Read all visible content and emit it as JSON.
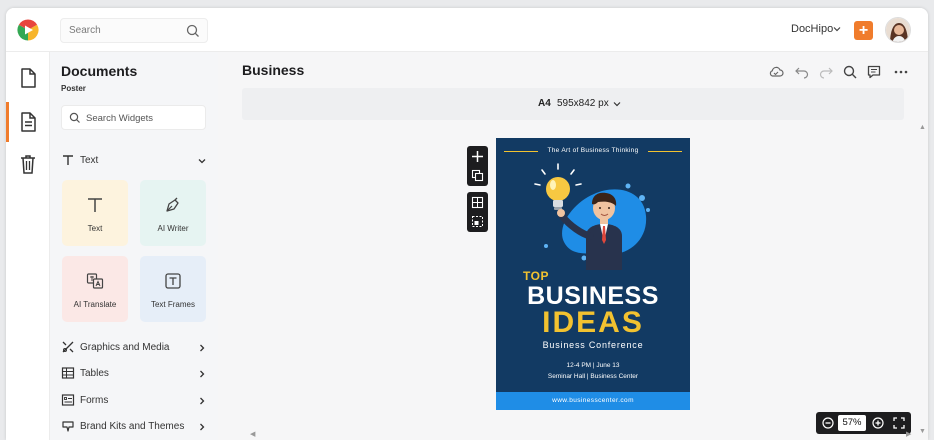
{
  "header": {
    "search_placeholder": "Search",
    "brand_menu": "DocHipo",
    "add_label": "+"
  },
  "panel": {
    "title": "Documents",
    "subtitle": "Poster",
    "search_placeholder": "Search Widgets",
    "text_section": "Text",
    "cards": [
      {
        "label": "Text",
        "bg": "#fdf3de"
      },
      {
        "label": "AI Writer",
        "bg": "#e6f4f2"
      },
      {
        "label": "AI Translate",
        "bg": "#fbe8e6"
      },
      {
        "label": "Text Frames",
        "bg": "#e6eef8"
      }
    ],
    "sections": [
      {
        "label": "Graphics and Media"
      },
      {
        "label": "Tables"
      },
      {
        "label": "Forms"
      },
      {
        "label": "Brand Kits and Themes"
      }
    ]
  },
  "main": {
    "doc_title": "Business",
    "format": "A4",
    "dimensions": "595x842 px",
    "zoom": "57%"
  },
  "poster": {
    "tagline": "The Art of Business Thinking",
    "top": "TOP",
    "headline": "BUSINESS",
    "highlight": "IDEAS",
    "event": "Business Conference",
    "time": "12-4 PM | June 13",
    "venue": "Seminar Hall | Business Center",
    "website": "www.businesscenter.com",
    "colors": {
      "bg": "#123a63",
      "accent": "#f2c230",
      "footer": "#1f8de6"
    }
  },
  "theme": {
    "accent": "#f07c2c"
  }
}
